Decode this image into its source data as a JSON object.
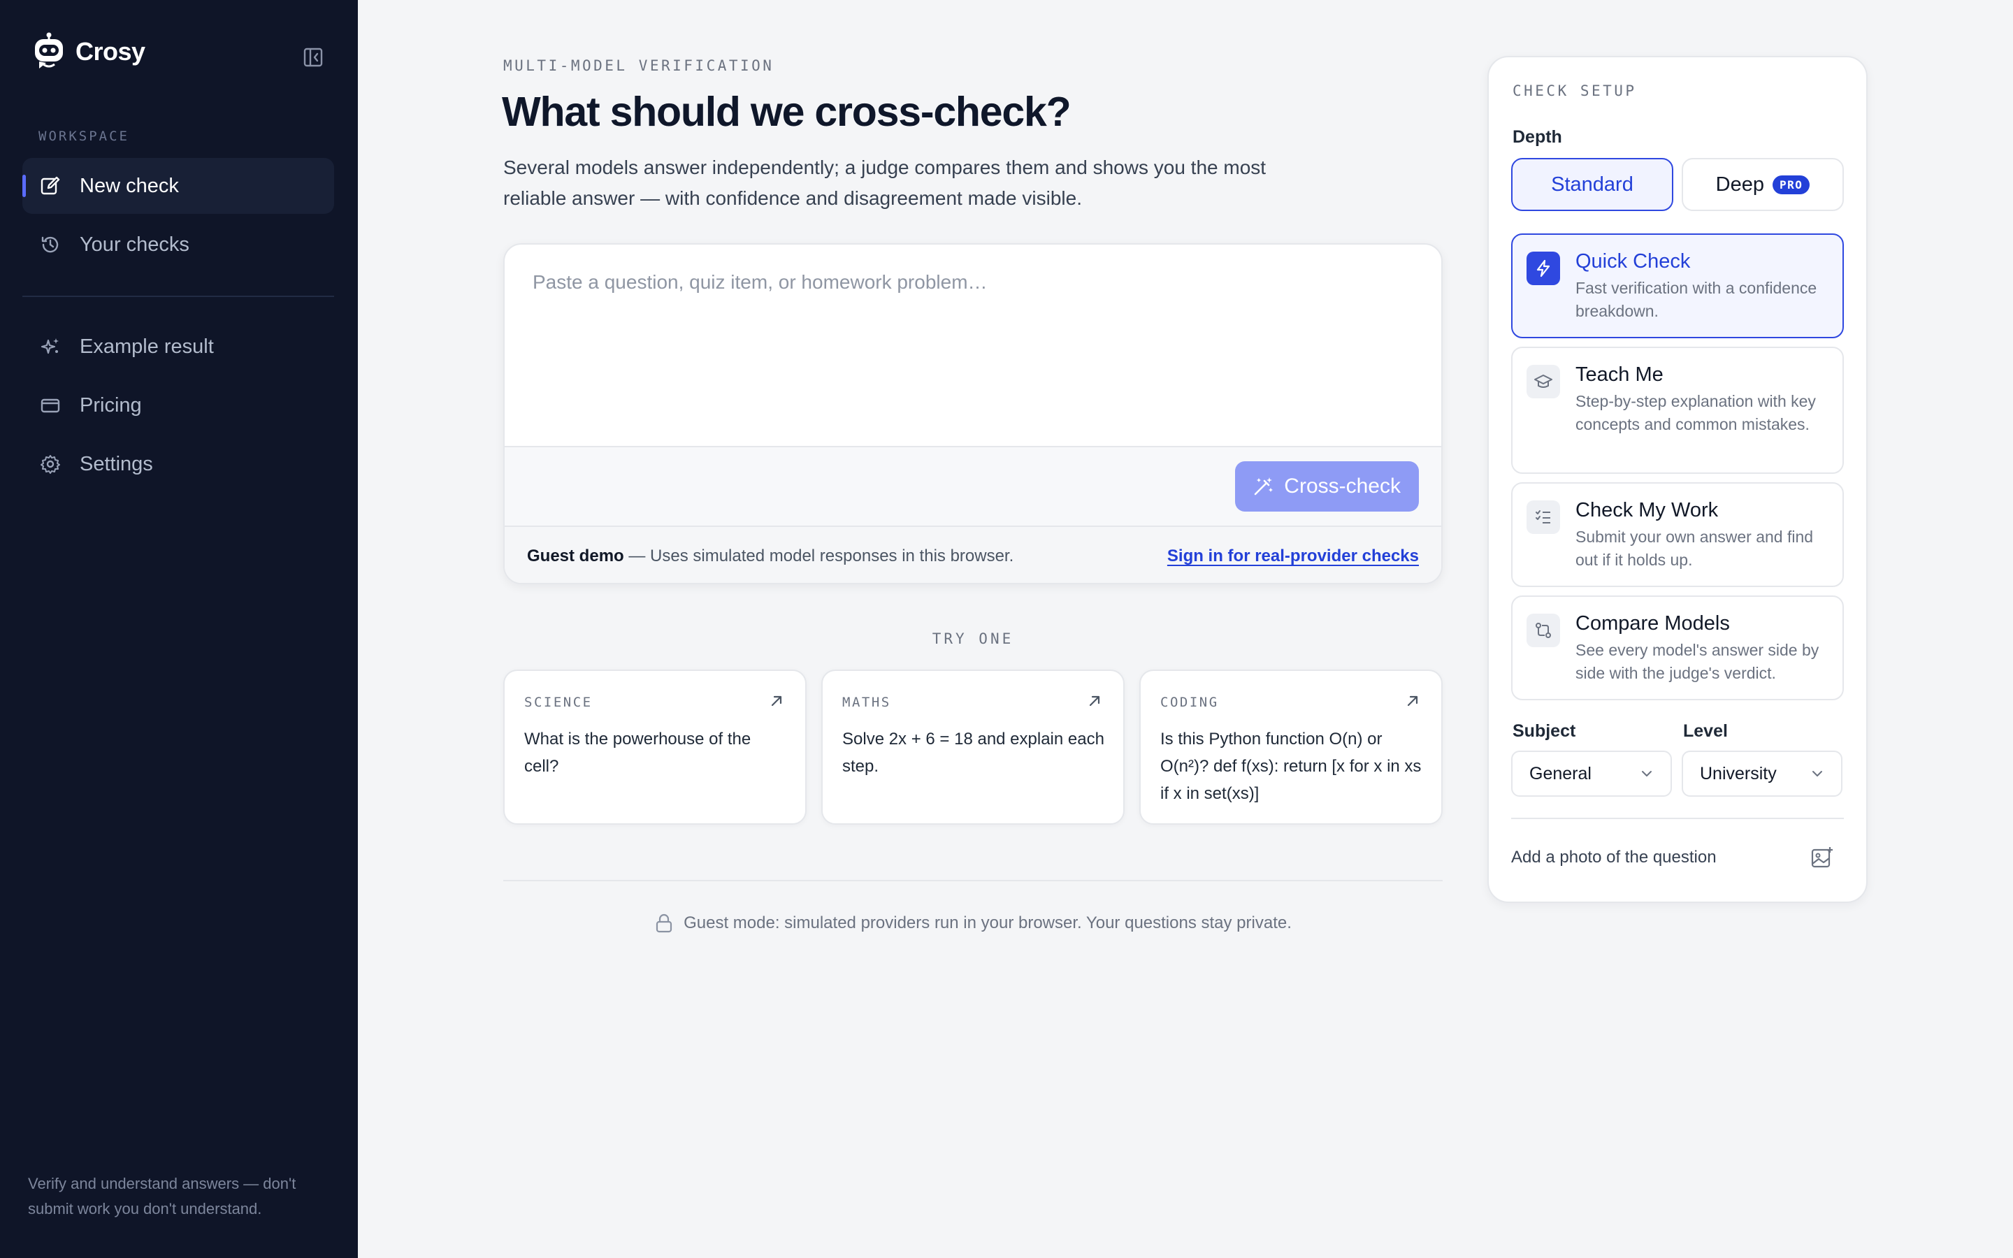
{
  "app": {
    "name": "Crosy"
  },
  "sidebar": {
    "section_label": "WORKSPACE",
    "items": [
      {
        "label": "New check",
        "icon": "edit-icon",
        "active": true
      },
      {
        "label": "Your checks",
        "icon": "history-icon",
        "active": false
      },
      {
        "label": "Example result",
        "icon": "sparkles-icon",
        "active": false
      },
      {
        "label": "Pricing",
        "icon": "credit-card-icon",
        "active": false
      },
      {
        "label": "Settings",
        "icon": "gear-icon",
        "active": false
      }
    ],
    "footer": "Verify and understand answers — don't submit work you don't understand."
  },
  "main": {
    "eyebrow": "MULTI-MODEL VERIFICATION",
    "title": "What should we cross-check?",
    "subtitle": "Several models answer independently; a judge compares them and shows you the most reliable answer — with confidence and disagreement made visible.",
    "composer": {
      "placeholder": "Paste a question, quiz item, or homework problem…",
      "value": "",
      "submit_label": "Cross-check"
    },
    "guest_bar": {
      "title": "Guest demo",
      "text": " — Uses simulated model responses in this browser.",
      "link": "Sign in for real-provider checks"
    },
    "try_label": "TRY ONE",
    "examples": [
      {
        "category": "SCIENCE",
        "question": "What is the powerhouse of the cell?"
      },
      {
        "category": "MATHS",
        "question": "Solve 2x + 6 = 18 and explain each step."
      },
      {
        "category": "CODING",
        "question": "Is this Python function O(n) or O(n²)? def f(xs): return [x for x in xs if x in set(xs)]"
      }
    ],
    "privacy_note": "Guest mode: simulated providers run in your browser. Your questions stay private."
  },
  "setup": {
    "title": "CHECK SETUP",
    "depth_label": "Depth",
    "depth_options": [
      {
        "label": "Standard",
        "selected": true
      },
      {
        "label": "Deep",
        "badge": "PRO",
        "selected": false
      }
    ],
    "modes": [
      {
        "title": "Quick Check",
        "desc": "Fast verification with a confidence breakdown.",
        "icon": "lightning-icon",
        "selected": true
      },
      {
        "title": "Teach Me",
        "desc": "Step-by-step explanation with key concepts and common mistakes.",
        "icon": "graduation-cap-icon",
        "selected": false
      },
      {
        "title": "Check My Work",
        "desc": "Submit your own answer and find out if it holds up.",
        "icon": "checklist-icon",
        "selected": false
      },
      {
        "title": "Compare Models",
        "desc": "See every model's answer side by side with the judge's verdict.",
        "icon": "compare-icon",
        "selected": false
      }
    ],
    "subject_label": "Subject",
    "subject_value": "General",
    "level_label": "Level",
    "level_value": "University",
    "photo_label": "Add a photo of the question"
  },
  "colors": {
    "sidebar_bg": "#0f1528",
    "accent": "#2340d8",
    "button_bg": "#8e9bf5",
    "page_bg": "#f4f5f7"
  }
}
